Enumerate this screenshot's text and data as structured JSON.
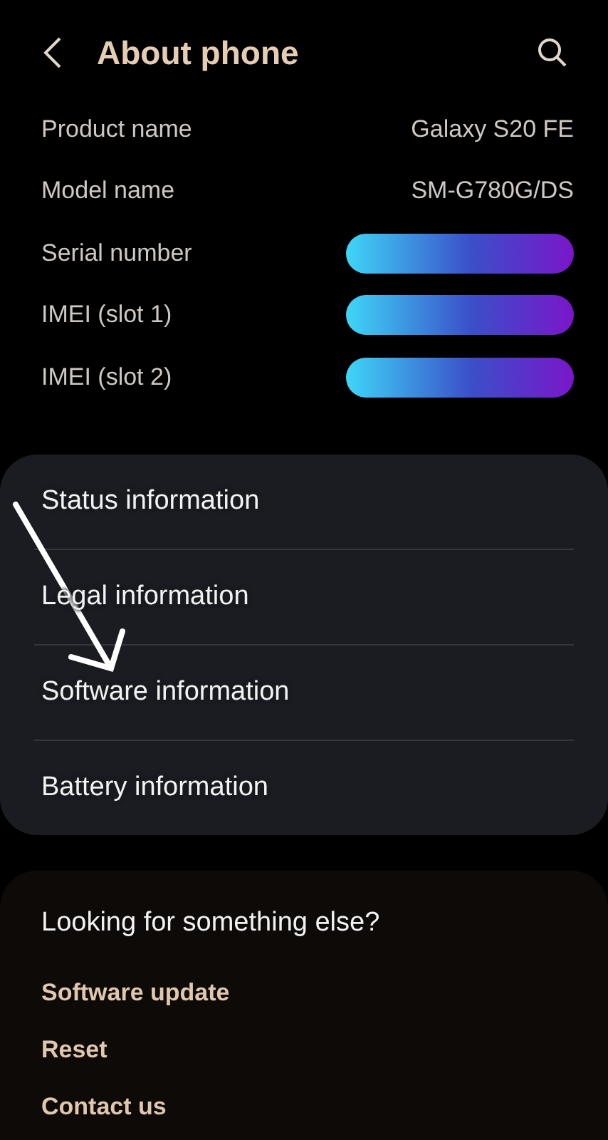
{
  "header": {
    "title": "About phone"
  },
  "info_rows": [
    {
      "label": "Product name",
      "kind": "text",
      "value": "Galaxy S20 FE"
    },
    {
      "label": "Model name",
      "kind": "text",
      "value": "SM-G780G/DS"
    },
    {
      "label": "Serial number",
      "kind": "redacted"
    },
    {
      "label": "IMEI (slot 1)",
      "kind": "redacted"
    },
    {
      "label": "IMEI (slot 2)",
      "kind": "redacted"
    }
  ],
  "menu": [
    "Status information",
    "Legal information",
    "Software information",
    "Battery information"
  ],
  "suggestions": {
    "title": "Looking for something else?",
    "links": [
      "Software update",
      "Reset",
      "Contact us"
    ]
  }
}
